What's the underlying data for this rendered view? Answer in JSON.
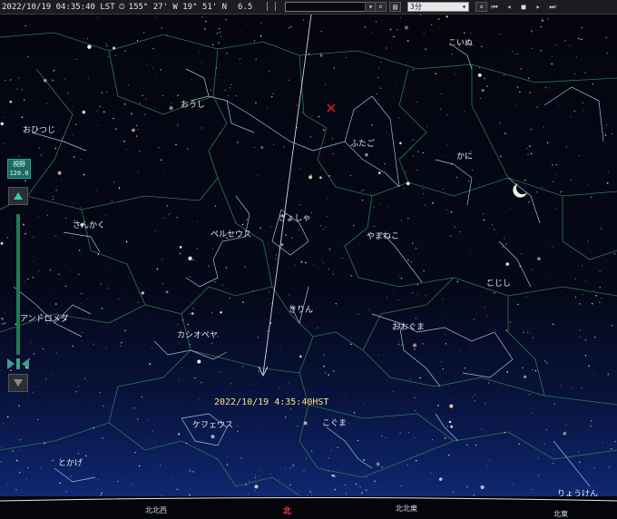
{
  "toolbar": {
    "datetime": "2022/10/19 04:35:40 LST",
    "location": "155° 27' W 19° 51' N",
    "magnitude": "6.5",
    "search_value": "",
    "step_value": "3分"
  },
  "side_panel": {
    "fov_title": "視野",
    "fov_value": "120.0"
  },
  "constellations": {
    "koinu": "こいぬ",
    "oushi": "おうし",
    "ohitsuji": "おひつじ",
    "futago": "ふたご",
    "kani": "かに",
    "sankaku": "さんかく",
    "gyosha": "ぎょしゃ",
    "yamaneko": "やまねこ",
    "perseus": "ペルセウス",
    "kojishi": "こじし",
    "andromeda": "アンドロメダ",
    "kirin": "きりん",
    "ooguma": "おおぐま",
    "cassiopeia": "カシオペヤ",
    "cepheus": "ケフェウス",
    "koguma": "こぐま",
    "tokage": "とかげ",
    "ryouken": "りょうけん"
  },
  "track_label": "2022/10/19 4:35:40HST",
  "horizon": {
    "nnw": "北北西",
    "n": "北",
    "nne": "北北東",
    "ne": "北東"
  },
  "colors": {
    "constellation_line": "#9fc3d6",
    "boundary_line": "#2e7a4e",
    "track_line": "#d8d8d8",
    "timestamp": "#ffe08a",
    "marker": "#e02020",
    "north": "#ff3a3a"
  }
}
